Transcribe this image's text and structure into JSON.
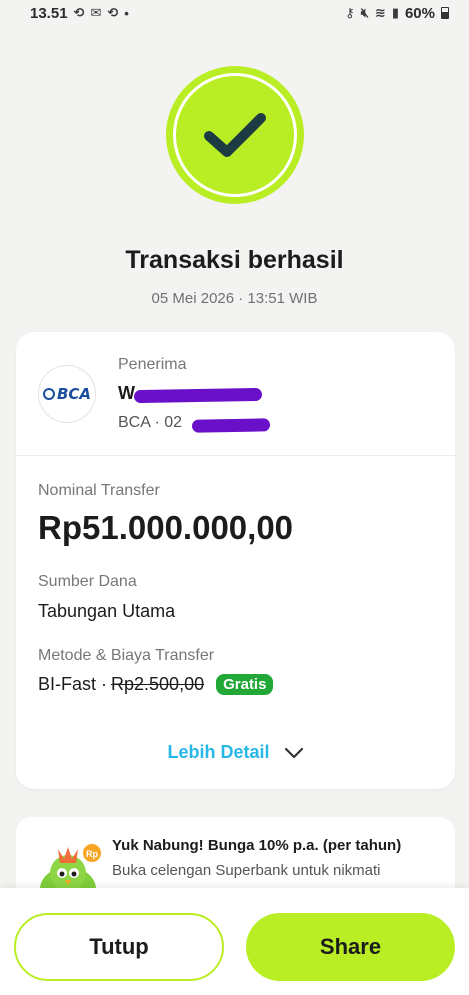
{
  "status_bar": {
    "time": "13.51",
    "battery": "60%"
  },
  "transaction": {
    "title": "Transaksi berhasil",
    "timestamp": "05 Mei 2026 · 13:51 WIB"
  },
  "recipient": {
    "label": "Penerima",
    "name": "W",
    "account": "BCA · 02",
    "bank_logo_text": "BCA"
  },
  "details": {
    "nominal_label": "Nominal Transfer",
    "nominal_value": "Rp51.000.000,00",
    "source_label": "Sumber Dana",
    "source_value": "Tabungan Utama",
    "method_label": "Metode & Biaya Transfer",
    "method_name": "BI-Fast ·",
    "method_fee": "Rp2.500,00",
    "fee_badge": "Gratis"
  },
  "more_detail": {
    "label": "Lebih Detail"
  },
  "promo": {
    "title": "Yuk Nabung! Bunga 10% p.a. (per tahun)",
    "text": "Buka celengan Superbank untuk nikmati"
  },
  "actions": {
    "close_label": "Tutup",
    "share_label": "Share"
  },
  "colors": {
    "accent": "#b9ee25",
    "link": "#28b8e8",
    "badge": "#22a836",
    "redaction": "#6a10c9"
  }
}
